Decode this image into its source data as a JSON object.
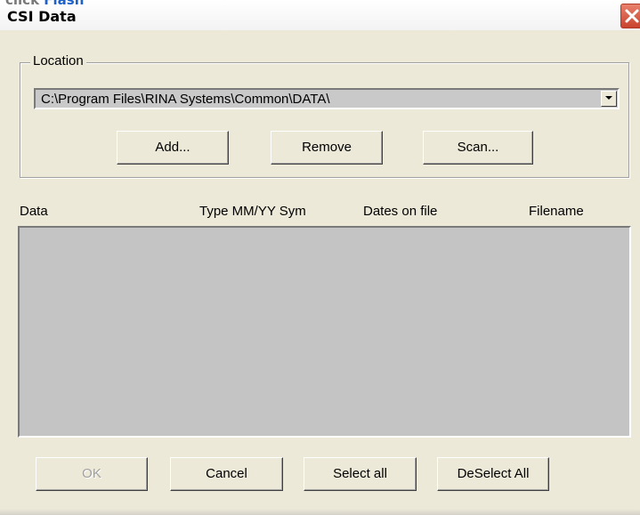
{
  "window": {
    "crumb_prefix": "click",
    "crumb_text": "Flash",
    "title": "CSI Data",
    "close_icon": "close-x-icon"
  },
  "location": {
    "legend": "Location",
    "path_value": "C:\\Program Files\\RINA Systems\\Common\\DATA\\",
    "dropdown_icon": "chevron-down-icon",
    "buttons": {
      "add": "Add...",
      "remove": "Remove",
      "scan": "Scan..."
    }
  },
  "list": {
    "columns": {
      "data": "Data",
      "type_date_sym": "Type MM/YY Sym",
      "dates_on_file": "Dates on file",
      "filename": "Filename"
    },
    "rows": []
  },
  "footer": {
    "ok": "OK",
    "cancel": "Cancel",
    "select_all": "Select all",
    "deselect_all": "DeSelect All"
  },
  "colors": {
    "dialog_bg": "#ece9d8",
    "list_bg": "#c4c4c4",
    "close_button": "#d55a43"
  }
}
